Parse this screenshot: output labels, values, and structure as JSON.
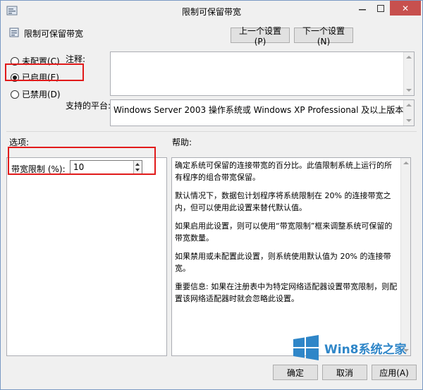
{
  "window": {
    "title": "限制可保留带宽",
    "close_glyph": "✕"
  },
  "header": {
    "policy_name": "限制可保留带宽",
    "prev_button": "上一个设置(P)",
    "next_button": "下一个设置(N)"
  },
  "state": {
    "options": [
      {
        "label": "未配置(C)",
        "checked": false
      },
      {
        "label": "已启用(E)",
        "checked": true
      },
      {
        "label": "已禁用(D)",
        "checked": false
      }
    ]
  },
  "comment": {
    "label": "注释:",
    "value": ""
  },
  "platform": {
    "label": "支持的平台:",
    "value": "Windows Server 2003 操作系统或 Windows XP Professional 及以上版本"
  },
  "options_section": {
    "title": "选项:",
    "bandwidth_label": "带宽限制 (%):",
    "bandwidth_value": "10"
  },
  "help_section": {
    "title": "帮助:",
    "paragraphs": [
      "确定系统可保留的连接带宽的百分比。此值限制系统上运行的所有程序的组合带宽保留。",
      "默认情况下，数据包计划程序将系统限制在 20% 的连接带宽之内，但可以使用此设置来替代默认值。",
      "如果启用此设置，则可以使用“带宽限制”框来调整系统可保留的带宽数量。",
      "如果禁用或未配置此设置，则系统使用默认值为 20% 的连接带宽。",
      "重要信息: 如果在注册表中为特定网络适配器设置带宽限制，则配置该网络适配器时就会忽略此设置。"
    ]
  },
  "footer": {
    "ok": "确定",
    "cancel": "取消",
    "apply": "应用(A)"
  },
  "watermark": {
    "text": "Win8系统之家"
  },
  "colors": {
    "highlight": "#e11a1a",
    "close_button": "#c7504e",
    "watermark": "#2f86c8"
  }
}
